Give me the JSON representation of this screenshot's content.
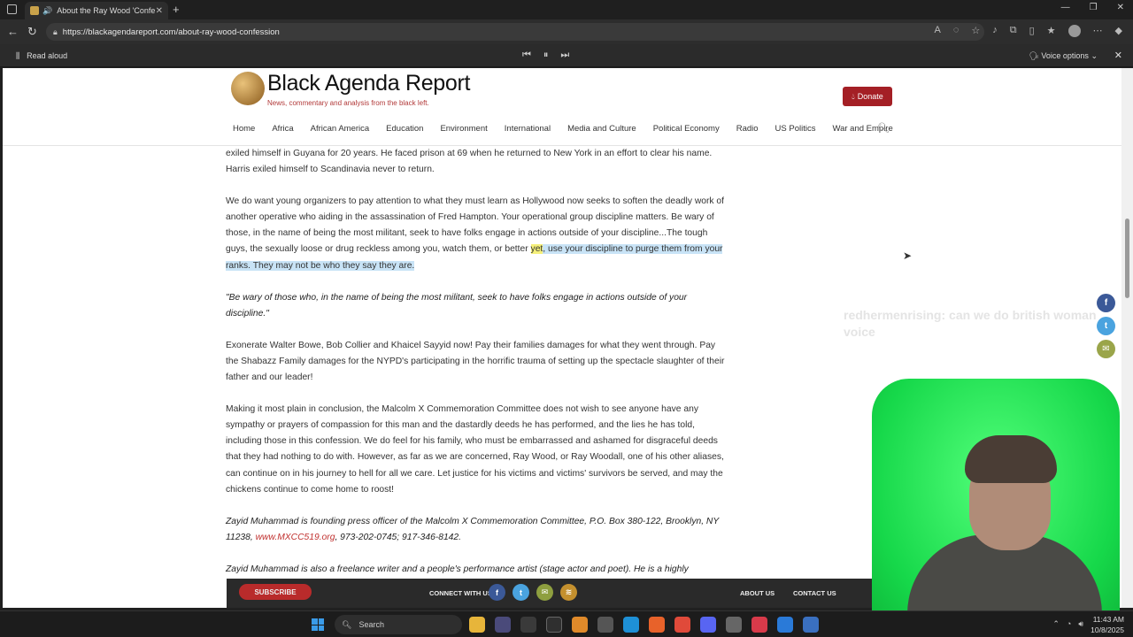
{
  "browser": {
    "tab_title": "About the Ray Wood 'Confe",
    "url": "https://blackagendareport.com/about-ray-wood-confession",
    "read_aloud_label": "Read aloud",
    "voice_options_label": "Voice options"
  },
  "site": {
    "title": "Black Agenda Report",
    "tagline": "News, commentary and analysis from the black left.",
    "donate_label": "Donate",
    "nav": [
      "Home",
      "Africa",
      "African America",
      "Education",
      "Environment",
      "International",
      "Media and Culture",
      "Political Economy",
      "Radio",
      "US Politics",
      "War and Empire"
    ]
  },
  "article": {
    "p1": "exiled himself in Guyana for 20 years. He faced prison at 69 when he returned to New York in an effort to clear his name. Harris exiled himself to Scandinavia never to return.",
    "p2_normal": "We do want young organizers to pay attention to what they must learn as Hollywood now seeks to soften the deadly work of another operative who aiding in the assassination of Fred Hampton. Your operational group discipline matters. Be wary of those, in the name of being the most militant, seek to have folks engage in actions outside of your discipline...The tough guys, the sexually loose or drug reckless among you, watch them, or better ",
    "p2_yellow": "yet",
    "p2_blue": ", use your discipline to purge them from your ranks. They may not be who they say they are.",
    "quote": "\"Be wary of those who, in the name of being the most militant, seek to have folks engage in actions outside of your discipline.\"",
    "p3": "Exonerate Walter Bowe, Bob Collier and Khaicel Sayyid now! Pay their families damages for what they went through. Pay the Shabazz Family damages for the NYPD's participating in the horrific trauma of setting up the spectacle slaughter of their father and our leader!",
    "p4": "Making it most plain in conclusion, the Malcolm X Commemoration Committee does not wish to see anyone have any sympathy or prayers of compassion for this man and the dastardly deeds he has performed, and the lies he has told, including those in this confession. We do feel for his family, who must be embarrassed and ashamed for disgraceful deeds that they had nothing to do with. However, as far as we are concerned, Ray Wood, or Ray Woodall, one of his other aliases, can continue on in his journey to hell for all we care. Let justice for his victims and victims' survivors be served, and may the chickens continue to come home to roost!",
    "bio1_a": "Zayid Muhammad is founding press officer of the Malcolm X Commemoration Committee, P.O. Box 380-122, Brooklyn, NY 11238, ",
    "bio1_link": "www.MXCC519.org",
    "bio1_b": ", 973-202-0745; 917-346-8142.",
    "bio2": "Zayid Muhammad is also a freelance writer and a people's performance artist (stage actor and poet). He is a highly"
  },
  "overlay_chat": "redhermenrising: can we do british woman voice",
  "footer": {
    "subscribe_label": "SUBSCRIBE",
    "connect_label": "CONNECT WITH US",
    "about_label": "ABOUT US",
    "contact_label": "CONTACT US"
  },
  "taskbar": {
    "search_placeholder": "Search",
    "time": "11:43 AM",
    "date": "10/8/2025"
  }
}
